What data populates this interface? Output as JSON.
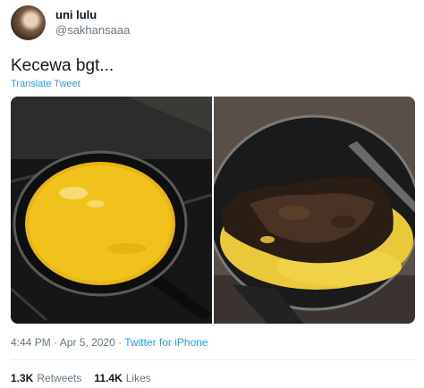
{
  "user": {
    "display_name": "uni lulu",
    "handle": "@sakhansaaa"
  },
  "tweet": {
    "text": "Kecewa bgt...",
    "translate_label": "Translate Tweet",
    "time": "4:44 PM",
    "date": "Apr 5, 2020",
    "separator": "·",
    "source": "Twitter for iPhone"
  },
  "stats": {
    "retweets_count": "1.3K",
    "retweets_label": "Retweets",
    "likes_count": "11.4K",
    "likes_label": "Likes"
  },
  "colors": {
    "link": "#1da1f2",
    "muted": "#657786",
    "text": "#14171a"
  }
}
